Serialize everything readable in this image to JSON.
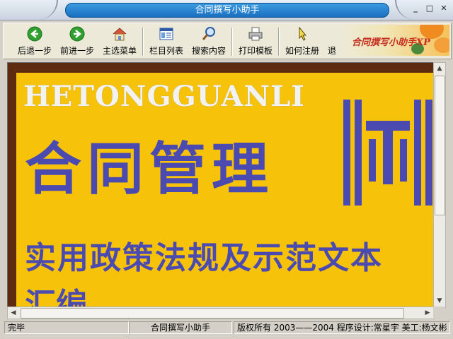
{
  "window": {
    "title": "合同撰写小助手"
  },
  "toolbar": {
    "items": [
      {
        "label": "后退一步",
        "icon": "back-arrow-icon"
      },
      {
        "label": "前进一步",
        "icon": "forward-arrow-icon"
      },
      {
        "label": "主选菜单",
        "icon": "home-icon"
      },
      {
        "label": "栏目列表",
        "icon": "list-window-icon"
      },
      {
        "label": "搜索内容",
        "icon": "magnifier-icon"
      },
      {
        "label": "打印模板",
        "icon": "printer-icon"
      },
      {
        "label": "如何注册",
        "icon": "pointer-icon"
      },
      {
        "label": "退",
        "icon": "exit-icon"
      }
    ],
    "logo_text": "合同撰写小助手XP"
  },
  "cover": {
    "english": "HETONGGUANLI",
    "title": "合同管理",
    "subtitle": "实用政策法规及示范文本",
    "subtitle2": "汇编"
  },
  "status": {
    "state": "完毕",
    "app": "合同撰写小助手",
    "copyright": "版权所有 2003——2004 程序设计:常星宇 美工:杨文彬"
  },
  "colors": {
    "cover_bg": "#f7c20a",
    "cover_text": "#4a4ab0",
    "title_bar": "#1a6fc0"
  }
}
